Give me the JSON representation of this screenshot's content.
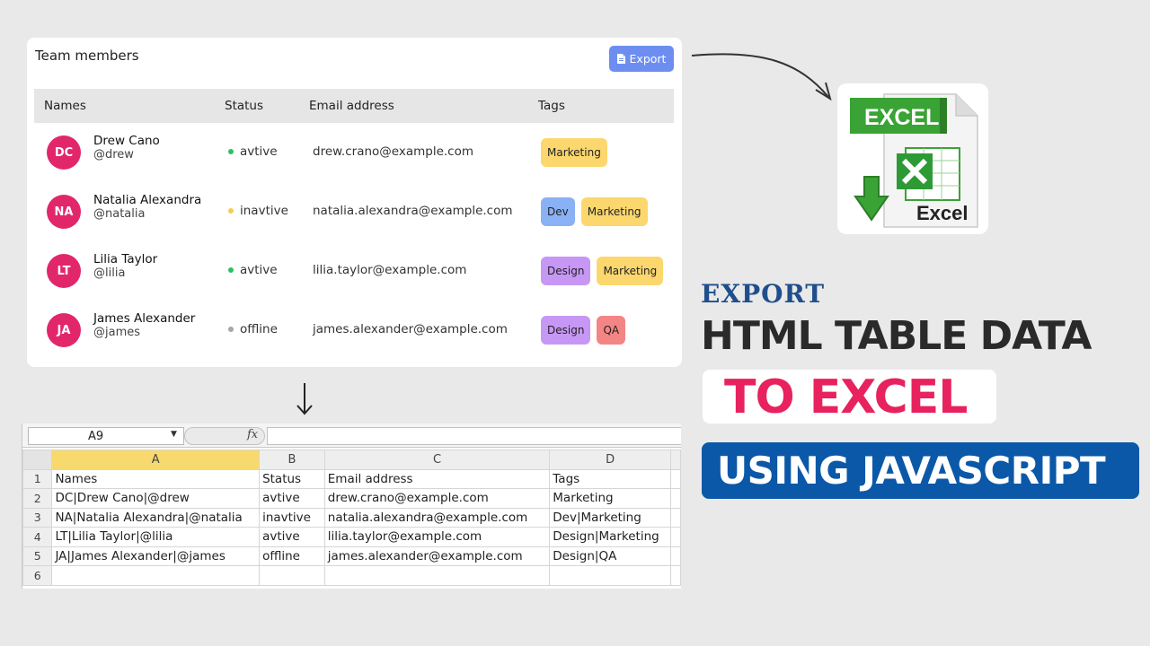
{
  "card": {
    "title": "Team members",
    "export_label": "Export",
    "columns": [
      "Names",
      "Status",
      "Email address",
      "Tags"
    ],
    "members": [
      {
        "initials": "DC",
        "name": "Drew Cano",
        "handle": "@drew",
        "status": "avtive",
        "status_color": "#2fbf63",
        "email": "drew.crano@example.com",
        "tags": [
          {
            "label": "Marketing",
            "color": "#fbd76e"
          }
        ]
      },
      {
        "initials": "NA",
        "name": "Natalia Alexandra",
        "handle": "@natalia",
        "status": "inavtive",
        "status_color": "#f5cb52",
        "email": "natalia.alexandra@example.com",
        "tags": [
          {
            "label": "Dev",
            "color": "#8ab1f5"
          },
          {
            "label": "Marketing",
            "color": "#fbd76e"
          }
        ]
      },
      {
        "initials": "LT",
        "name": "Lilia Taylor",
        "handle": "@lilia",
        "status": "avtive",
        "status_color": "#2fbf63",
        "email": "lilia.taylor@example.com",
        "tags": [
          {
            "label": "Design",
            "color": "#c797f5"
          },
          {
            "label": "Marketing",
            "color": "#fbd76e"
          }
        ]
      },
      {
        "initials": "JA",
        "name": "James Alexander",
        "handle": "@james",
        "status": "offline",
        "status_color": "#a5a5a5",
        "email": "james.alexander@example.com",
        "tags": [
          {
            "label": "Design",
            "color": "#c797f5"
          },
          {
            "label": "QA",
            "color": "#f48585"
          }
        ]
      }
    ]
  },
  "excel_icon": {
    "banner": "EXCEL",
    "caption": "Excel"
  },
  "headline": {
    "line1": "EXPORT",
    "line2": "HTML TABLE DATA",
    "line3": "TO EXCEL",
    "line4": "USING JAVASCRIPT"
  },
  "sheet": {
    "name_box": "A9",
    "fx": "fx",
    "columns": [
      "A",
      "B",
      "C",
      "D"
    ],
    "selected_column": "A",
    "rows": [
      {
        "num": "1",
        "cells": [
          "Names",
          "Status",
          "Email address",
          "Tags"
        ]
      },
      {
        "num": "2",
        "cells": [
          "DC|Drew Cano|@drew",
          "avtive",
          "drew.crano@example.com",
          "Marketing"
        ]
      },
      {
        "num": "3",
        "cells": [
          "NA|Natalia Alexandra|@natalia",
          "inavtive",
          "natalia.alexandra@example.com",
          "Dev|Marketing"
        ]
      },
      {
        "num": "4",
        "cells": [
          "LT|Lilia Taylor|@lilia",
          "avtive",
          "lilia.taylor@example.com",
          "Design|Marketing"
        ]
      },
      {
        "num": "5",
        "cells": [
          "JA|James Alexander|@james",
          "offline",
          "james.alexander@example.com",
          "Design|QA"
        ]
      },
      {
        "num": "6",
        "cells": [
          "",
          "",
          "",
          ""
        ]
      }
    ]
  },
  "colors": {
    "avatar": "#e2266a",
    "export_button": "#6d8ef0",
    "accent_pink": "#e8225e",
    "accent_blue": "#0b58a8"
  }
}
